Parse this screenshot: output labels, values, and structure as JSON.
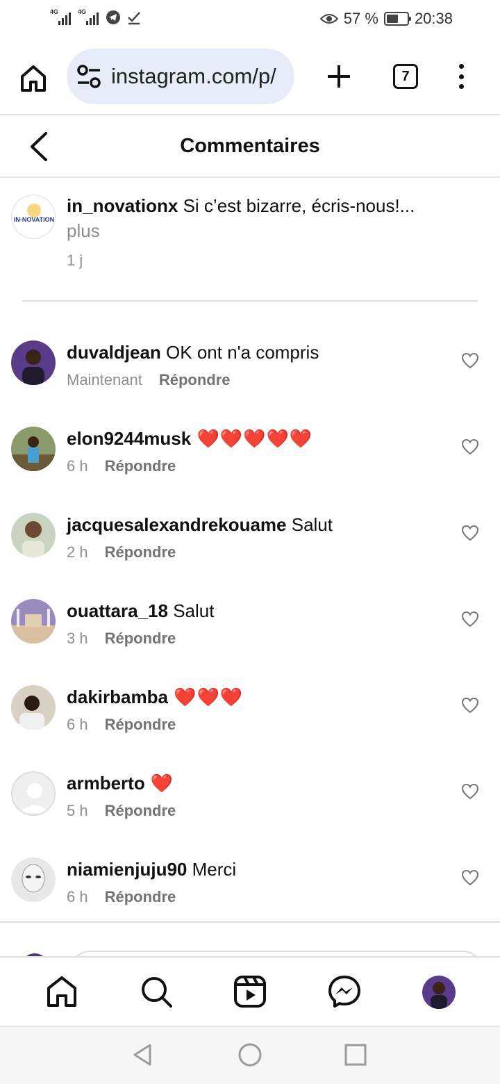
{
  "status_bar": {
    "network_1": "4G",
    "network_2": "4G",
    "battery_percent": "57 %",
    "battery_level": 0.57,
    "time": "20:38"
  },
  "browser": {
    "url": "instagram.com/p/",
    "tab_count": "7"
  },
  "header": {
    "title": "Commentaires"
  },
  "caption": {
    "username": "in_novationx",
    "text": " Si c’est bizarre, écris-nous!...",
    "more": "plus",
    "age": "1 j",
    "avatar_text": "IN-NOVATION"
  },
  "comments": [
    {
      "username": "duvaldjean",
      "text": " OK ont n'a compris",
      "time": "Maintenant",
      "reply": "Répondre"
    },
    {
      "username": "elon9244musk",
      "text": " ❤️❤️❤️❤️❤️",
      "time": "6 h",
      "reply": "Répondre"
    },
    {
      "username": "jacquesalexandrekouame",
      "text": " Salut",
      "time": "2 h",
      "reply": "Répondre"
    },
    {
      "username": "ouattara_18",
      "text": " Salut",
      "time": "3 h",
      "reply": "Répondre"
    },
    {
      "username": "dakirbamba",
      "text": " ❤️❤️❤️",
      "time": "6 h",
      "reply": "Répondre"
    },
    {
      "username": "armberto",
      "text": " ❤️",
      "time": "5 h",
      "reply": "Répondre"
    },
    {
      "username": "niamienjuju90",
      "text": " Merci",
      "time": "6 h",
      "reply": "Répondre"
    }
  ],
  "icons": {
    "home": "home-icon",
    "search": "search-icon",
    "reels": "reels-icon",
    "messenger": "messenger-icon",
    "heart": "heart-icon"
  },
  "colors": {
    "heart_red": "#e0152d",
    "url_bar_bg": "#e7edf8",
    "muted_text": "#8e8e8e"
  }
}
